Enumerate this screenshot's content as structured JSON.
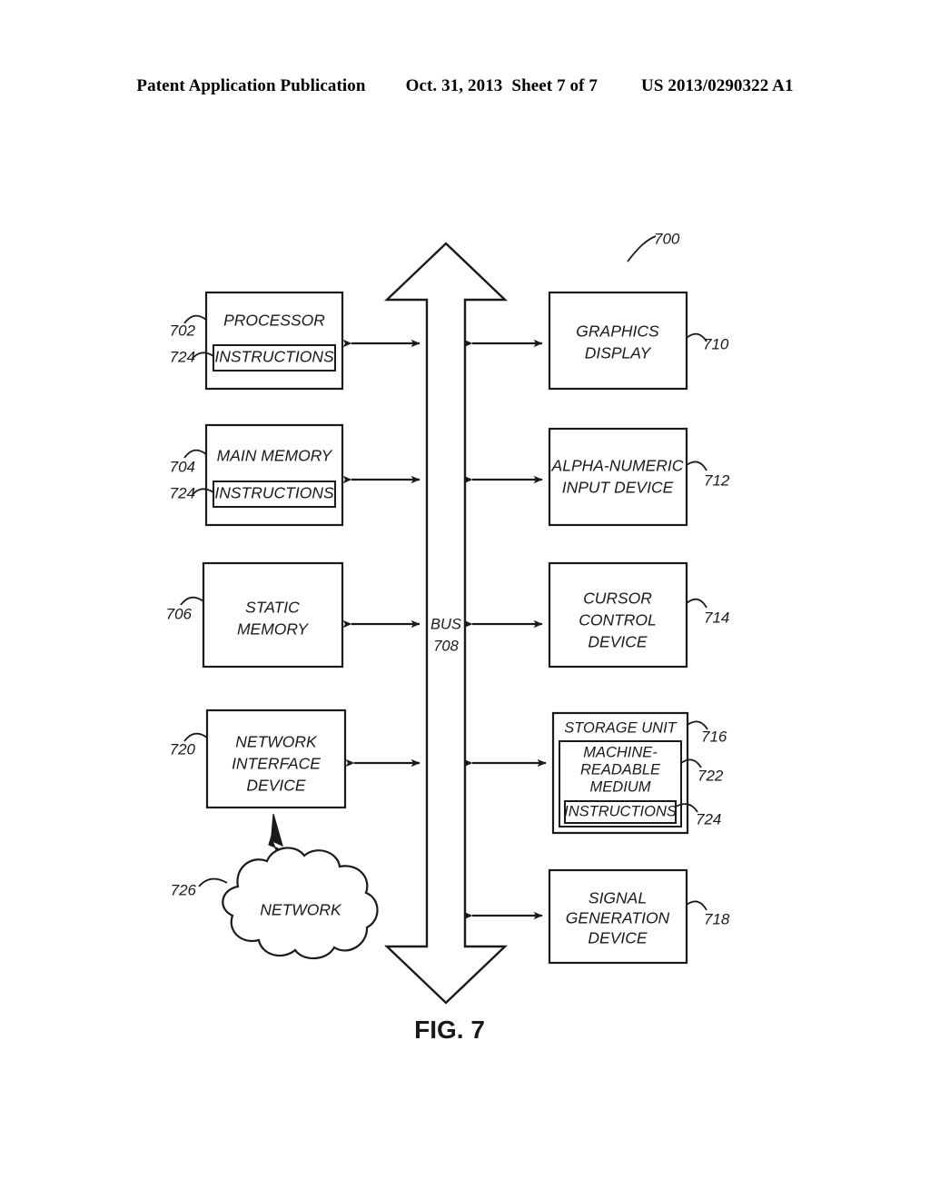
{
  "header": {
    "publication": "Patent Application Publication",
    "date": "Oct. 31, 2013",
    "sheet": "Sheet 7 of 7",
    "number": "US 2013/0290322 A1"
  },
  "figure": {
    "caption": "FIG. 7",
    "system_ref": "700",
    "bus": {
      "label": "BUS",
      "ref": "708"
    },
    "left_column": [
      {
        "label": "PROCESSOR",
        "ref": "702",
        "inner_label": "INSTRUCTIONS",
        "inner_ref": "724"
      },
      {
        "label": "MAIN MEMORY",
        "ref": "704",
        "inner_label": "INSTRUCTIONS",
        "inner_ref": "724"
      },
      {
        "label": "STATIC MEMORY",
        "line1": "STATIC",
        "line2": "MEMORY",
        "ref": "706"
      },
      {
        "label": "NETWORK INTERFACE DEVICE",
        "line1": "NETWORK",
        "line2": "INTERFACE",
        "line3": "DEVICE",
        "ref": "720"
      }
    ],
    "network": {
      "label": "NETWORK",
      "ref": "726"
    },
    "right_column": [
      {
        "label": "GRAPHICS DISPLAY",
        "line1": "GRAPHICS",
        "line2": "DISPLAY",
        "ref": "710"
      },
      {
        "label": "ALPHA-NUMERIC INPUT DEVICE",
        "line1": "ALPHA-NUMERIC",
        "line2": "INPUT DEVICE",
        "ref": "712"
      },
      {
        "label": "CURSOR CONTROL DEVICE",
        "line1": "CURSOR",
        "line2": "CONTROL",
        "line3": "DEVICE",
        "ref": "714"
      },
      {
        "label": "STORAGE UNIT",
        "ref": "716",
        "medium_line1": "MACHINE-",
        "medium_line2": "READABLE",
        "medium_line3": "MEDIUM",
        "medium_ref": "722",
        "instructions_label": "INSTRUCTIONS",
        "instructions_ref": "724"
      },
      {
        "label": "SIGNAL GENERATION DEVICE",
        "line1": "SIGNAL",
        "line2": "GENERATION",
        "line3": "DEVICE",
        "ref": "718"
      }
    ]
  },
  "colors": {
    "ink": "#1a1a1a",
    "paper": "#ffffff"
  }
}
